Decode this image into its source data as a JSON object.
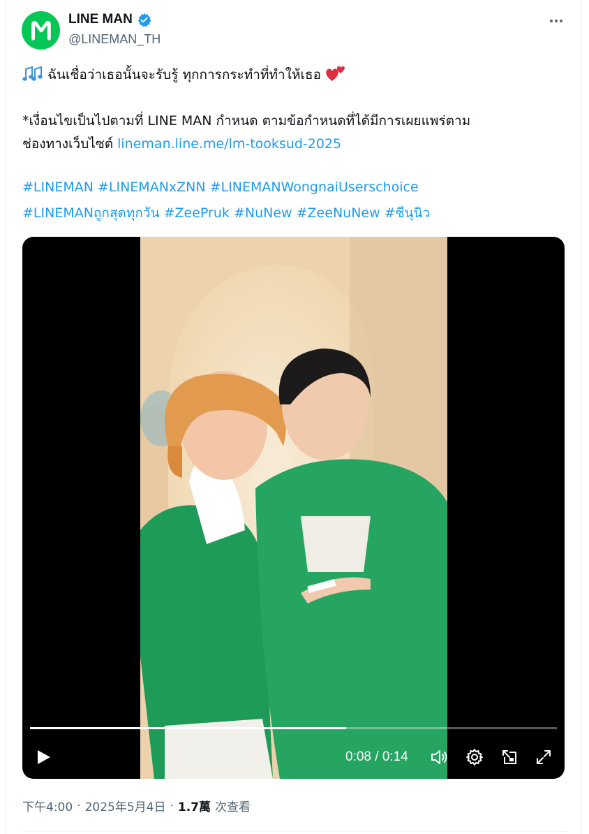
{
  "account": {
    "display_name": "LINE MAN",
    "handle": "@LINEMAN_TH",
    "verified": true,
    "avatar_letter": "M",
    "brand_color": "#06c755",
    "verified_color": "#1d9bf0"
  },
  "tweet": {
    "line1": "ฉันเชื่อว่าเธอนั้นจะรับรู้ ทุกการกระทำที่ทำให้เธอ",
    "line1_prefix_icon": "music-notes-emoji",
    "line1_suffix_icon": "two-hearts-emoji",
    "line2": "*เงื่อนไขเป็นไปตามที่ LINE MAN กำหนด ตามข้อกำหนดที่ได้มีการเผยแพร่ตาม",
    "line3_text": "ช่องทางเว็บไซต์",
    "line3_link": "lineman.line.me/lm-tooksud-2025",
    "hashtags_row1": [
      "#LINEMAN",
      "#LINEMANxZNN",
      "#LINEMANWongnaiUserschoice"
    ],
    "hashtags_row2": [
      "#LINEMANถูกสุดทุกวัน",
      "#ZeePruk",
      "#NuNew",
      "#ZeeNuNew",
      "#ซีนุนิว"
    ]
  },
  "video": {
    "current_time": "0:08",
    "total_time": "0:14",
    "time_display": "0:08 / 0:14",
    "progress_fraction": 0.6,
    "controls": [
      "play-icon",
      "volume-icon",
      "settings-icon",
      "pip-icon",
      "fullscreen-icon"
    ]
  },
  "meta": {
    "time": "下午4:00",
    "date": "2025年5月4日",
    "views_count": "1.7萬",
    "views_label": "次查看",
    "separator": "·"
  }
}
